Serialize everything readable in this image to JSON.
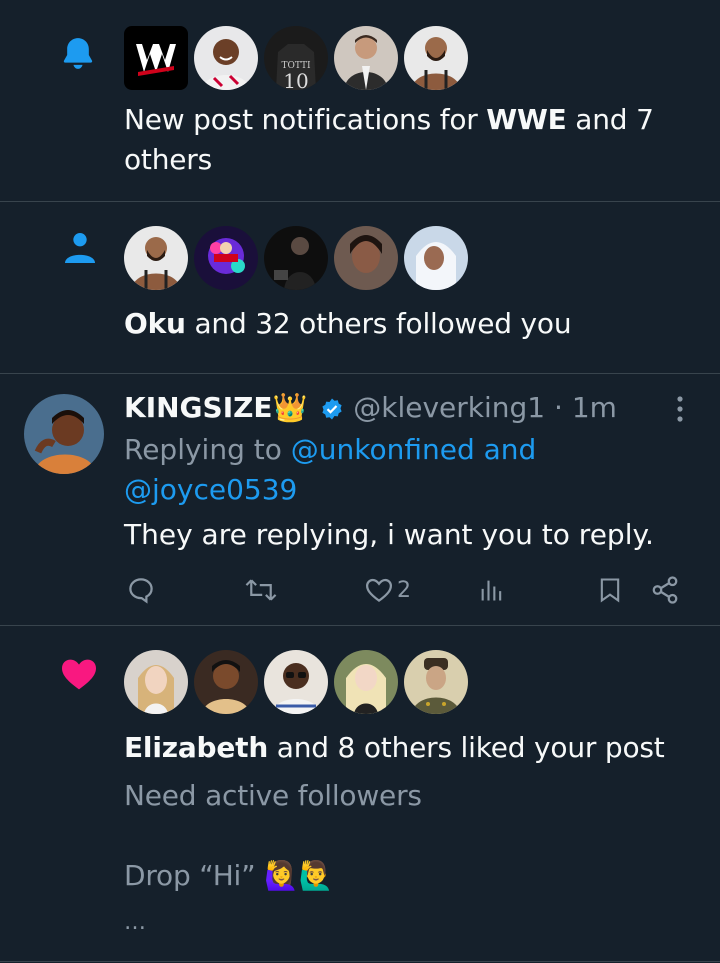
{
  "notifications": [
    {
      "type": "new-post",
      "text_pre": "New post notifications for ",
      "text_bold": "WWE",
      "text_post": " and 7 others",
      "icon": "bell-icon",
      "icon_color": "#1d9bf0",
      "avatars": [
        "wwe-logo-avatar",
        "smiling-man-avatar",
        "jersey-totti-10-avatar",
        "man-in-vest-avatar",
        "bearded-man-avatar"
      ]
    },
    {
      "type": "follow",
      "text_bold": "Oku",
      "text_post": " and 32 others followed you",
      "icon": "person-icon",
      "icon_color": "#1d9bf0",
      "avatars": [
        "bearded-man-avatar",
        "neon-graphic-avatar",
        "dark-portrait-avatar",
        "woman-portrait-avatar",
        "hijab-woman-avatar"
      ]
    },
    {
      "type": "like",
      "text_bold": "Elizabeth",
      "text_post": " and 8 others liked your post",
      "icon": "heart-icon",
      "icon_color": "#f91880",
      "post_line1": "Need active followers",
      "post_line2": "Drop “Hi” 🙋‍♀️🙋‍♂️",
      "ellipsis": "…",
      "avatars": [
        "blonde-woman-avatar",
        "cartoon-man-avatar",
        "man-with-glasses-avatar",
        "blonde-woman-2-avatar",
        "historic-officer-avatar"
      ]
    }
  ],
  "tweet": {
    "name": "KINGSIZE👑",
    "handle": "@kleverking1",
    "separator": "·",
    "time": "1m",
    "replying_label": "Replying to ",
    "mention1": "@unkonfined",
    "and_label": " and",
    "mention2": "@joyce0539",
    "body": "They are replying, i want you to reply.",
    "likes": "2",
    "verified_color": "#1d9bf0"
  }
}
